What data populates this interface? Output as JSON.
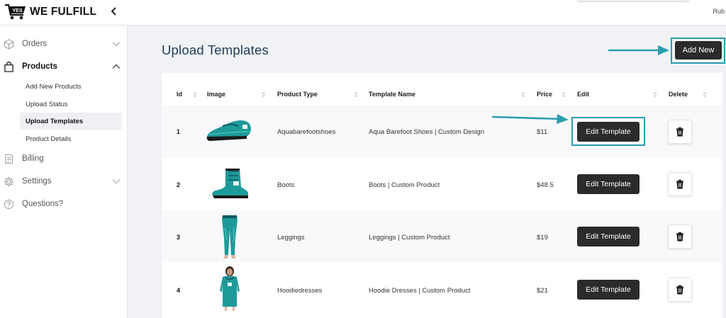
{
  "header": {
    "logo_badge": "YES",
    "logo_text": "WE FULFILL",
    "user_name": "Rub"
  },
  "sidebar": {
    "items": [
      {
        "label": "Orders",
        "icon": "box-icon"
      },
      {
        "label": "Products",
        "icon": "shopping-bag-icon"
      },
      {
        "label": "Billing",
        "icon": "invoice-icon"
      },
      {
        "label": "Settings",
        "icon": "gear-icon"
      },
      {
        "label": "Questions?",
        "icon": "help-circle-icon"
      }
    ],
    "products_sub": [
      {
        "label": "Add New Products"
      },
      {
        "label": "Upload Status"
      },
      {
        "label": "Upload Templates",
        "active": true
      },
      {
        "label": "Product Details"
      }
    ]
  },
  "main": {
    "title": "Upload Templates",
    "add_new_label": "Add New",
    "columns": [
      "Id",
      "Image",
      "Product Type",
      "Template Name",
      "Price",
      "Edit",
      "Delete"
    ],
    "rows": [
      {
        "id": "1",
        "image": "aqua-barefoot-shoe",
        "product_type": "Aquabarefootshoes",
        "template_name": "Aqua Barefoot Shoes | Custom Design",
        "price": "$11",
        "edit_label": "Edit Template"
      },
      {
        "id": "2",
        "image": "boot",
        "product_type": "Boots",
        "template_name": "Boots | Custom Product",
        "price": "$48.5",
        "edit_label": "Edit Template"
      },
      {
        "id": "3",
        "image": "leggings",
        "product_type": "Leggings",
        "template_name": "Leggings | Custom Product",
        "price": "$19",
        "edit_label": "Edit Template"
      },
      {
        "id": "4",
        "image": "hoodie-dress",
        "product_type": "Hoodiedresses",
        "template_name": "Hoodie Dresses | Custom Product",
        "price": "$21",
        "edit_label": "Edit Template"
      }
    ]
  },
  "colors": {
    "highlight": "#2a9db0",
    "button_dark": "#2b2b2b",
    "title": "#1d3c5a",
    "product_teal": "#1e9a9a"
  }
}
